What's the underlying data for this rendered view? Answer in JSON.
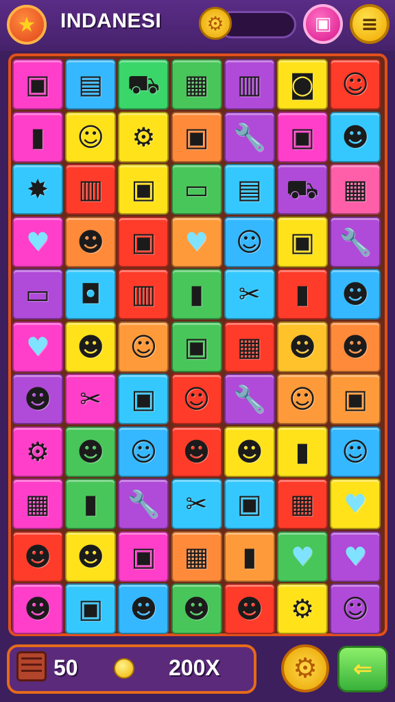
{
  "header": {
    "title": "INDANESI",
    "level_progress": 0.0
  },
  "board": {
    "rows": 11,
    "cols": 7,
    "tiles": [
      [
        "#ff3fc9",
        "projector"
      ],
      [
        "#35b8ff",
        "microwave"
      ],
      [
        "#3ad66a",
        "toy-car"
      ],
      [
        "#48c65a",
        "crate"
      ],
      [
        "#b04ad8",
        "radio"
      ],
      [
        "#ffe21a",
        "camera"
      ],
      [
        "#ff3b2a",
        "girl-face"
      ],
      [
        "#ff3fc9",
        "usb-drive"
      ],
      [
        "#ffe21a",
        "girl-face"
      ],
      [
        "#ffe21a",
        "gear"
      ],
      [
        "#ff8a3a",
        "projector"
      ],
      [
        "#b04ad8",
        "wrench"
      ],
      [
        "#ff3fc9",
        "projector"
      ],
      [
        "#35c8ff",
        "boy-face"
      ],
      [
        "#35c8ff",
        "explosion"
      ],
      [
        "#ff3b2a",
        "radio"
      ],
      [
        "#ffe21a",
        "projector"
      ],
      [
        "#48c65a",
        "battery"
      ],
      [
        "#35c8ff",
        "microwave"
      ],
      [
        "#b04ad8",
        "toy-car"
      ],
      [
        "#ff5fa8",
        "crate"
      ],
      [
        "#ff3fc9",
        "heart"
      ],
      [
        "#ff8a3a",
        "boy-face"
      ],
      [
        "#ff3b2a",
        "projector"
      ],
      [
        "#ff9a3a",
        "heart"
      ],
      [
        "#35b8ff",
        "girl-face"
      ],
      [
        "#ffe21a",
        "projector"
      ],
      [
        "#b04ad8",
        "wrench"
      ],
      [
        "#b04ad8",
        "battery"
      ],
      [
        "#35c8ff",
        "speaker"
      ],
      [
        "#ff3b2a",
        "radio"
      ],
      [
        "#48c65a",
        "usb-drive"
      ],
      [
        "#35c8ff",
        "tools"
      ],
      [
        "#ff3b2a",
        "usb-drive"
      ],
      [
        "#35b8ff",
        "boy-face"
      ],
      [
        "#ff3fc9",
        "heart"
      ],
      [
        "#ffe21a",
        "boy-face"
      ],
      [
        "#ff9a3a",
        "girl-face"
      ],
      [
        "#48c65a",
        "projector"
      ],
      [
        "#ff3b2a",
        "crate"
      ],
      [
        "#ffc22a",
        "boy-face"
      ],
      [
        "#ff8a3a",
        "boy-face"
      ],
      [
        "#b04ad8",
        "boy-face"
      ],
      [
        "#ff3fc9",
        "tools"
      ],
      [
        "#35c8ff",
        "projector"
      ],
      [
        "#ff3b2a",
        "girl-face"
      ],
      [
        "#b04ad8",
        "wrench"
      ],
      [
        "#ff9a3a",
        "girl-face"
      ],
      [
        "#ff9a3a",
        "projector"
      ],
      [
        "#ff3fc9",
        "gear"
      ],
      [
        "#48c65a",
        "boy-face"
      ],
      [
        "#35b8ff",
        "girl-face"
      ],
      [
        "#ff3b2a",
        "boy-face"
      ],
      [
        "#ffe21a",
        "boy-face"
      ],
      [
        "#ffe21a",
        "usb-drive"
      ],
      [
        "#35b8ff",
        "girl-face"
      ],
      [
        "#ff3fc9",
        "crate"
      ],
      [
        "#48c65a",
        "usb-drive"
      ],
      [
        "#b04ad8",
        "wrench"
      ],
      [
        "#35c8ff",
        "tools"
      ],
      [
        "#35c8ff",
        "projector"
      ],
      [
        "#ff3b2a",
        "crate"
      ],
      [
        "#ffe21a",
        "heart"
      ],
      [
        "#ff3b2a",
        "boy-face"
      ],
      [
        "#ffe21a",
        "boy-face"
      ],
      [
        "#ff3fc9",
        "projector"
      ],
      [
        "#ff8a3a",
        "crate"
      ],
      [
        "#ff9a3a",
        "usb-drive"
      ],
      [
        "#48c65a",
        "heart"
      ],
      [
        "#b04ad8",
        "heart"
      ],
      [
        "#ff3fc9",
        "boy-face"
      ],
      [
        "#35c8ff",
        "projector"
      ],
      [
        "#35b8ff",
        "boy-face"
      ],
      [
        "#48c65a",
        "boy-face"
      ],
      [
        "#ff3b2a",
        "boy-face"
      ],
      [
        "#ffe21a",
        "gear"
      ],
      [
        "#b04ad8",
        "girl-face"
      ]
    ]
  },
  "footer": {
    "moves": "50",
    "score": "200X"
  }
}
